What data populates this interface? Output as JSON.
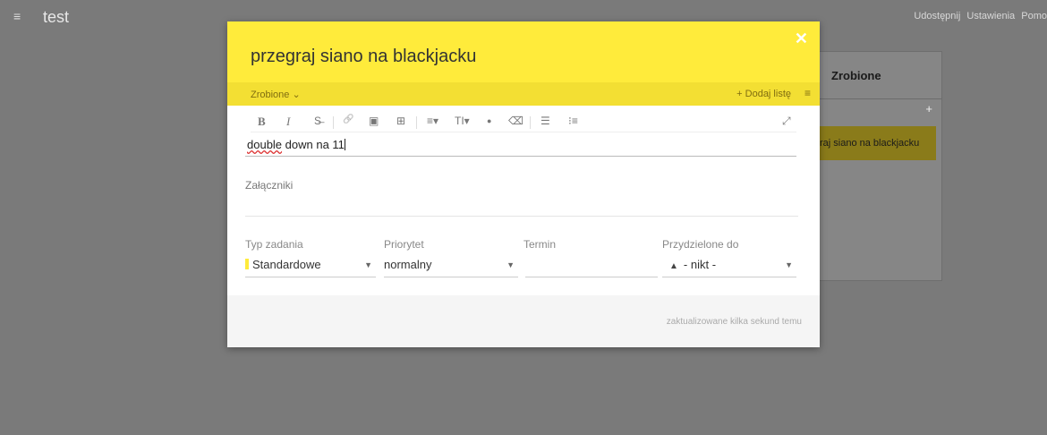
{
  "topbar": {
    "menu_icon": "hamburger-icon",
    "board_title": "test",
    "links": [
      "Udostępnij",
      "Ustawienia",
      "Pomo"
    ]
  },
  "column": {
    "title": "Zrobione",
    "add_label": "+",
    "card_text": "raj siano na blackjacku"
  },
  "modal": {
    "close_label": "✕",
    "task_title": "przegraj siano na blackjacku",
    "status": "Zrobione",
    "status_chevron": "⌄",
    "add_list": "+ Dodaj listę",
    "menu_icon": "≡",
    "editor": {
      "toolbar": [
        {
          "name": "bold-icon",
          "glyph": "B"
        },
        {
          "name": "italic-icon",
          "glyph": "I"
        },
        {
          "name": "strikethrough-icon",
          "glyph": "S̶"
        },
        {
          "name": "link-icon",
          "glyph": "🔗"
        },
        {
          "name": "image-icon",
          "glyph": "▣"
        },
        {
          "name": "table-icon",
          "glyph": "⊞"
        },
        {
          "name": "align-icon",
          "glyph": "≡▾"
        },
        {
          "name": "text-size-icon",
          "glyph": "TI▾"
        },
        {
          "name": "color-icon",
          "glyph": "●"
        },
        {
          "name": "eraser-icon",
          "glyph": "⌫"
        },
        {
          "name": "bullet-list-icon",
          "glyph": "☰"
        },
        {
          "name": "numbered-list-icon",
          "glyph": "⁝≡"
        },
        {
          "name": "expand-icon",
          "glyph": "⤢"
        }
      ],
      "content_word": "double",
      "content_rest": " down na 11"
    },
    "attachments_label": "Załączniki",
    "fields": {
      "type_label": "Typ zadania",
      "type_value": "Standardowe",
      "priority_label": "Priorytet",
      "priority_value": "normalny",
      "due_label": "Termin",
      "due_value": "",
      "assignee_label": "Przydzielone do",
      "assignee_value": "- nikt -"
    },
    "updated_text": "zaktualizowane kilka sekund temu"
  },
  "colors": {
    "accent_yellow": "#ffeb3b",
    "overlay": "#7a7a7a"
  }
}
